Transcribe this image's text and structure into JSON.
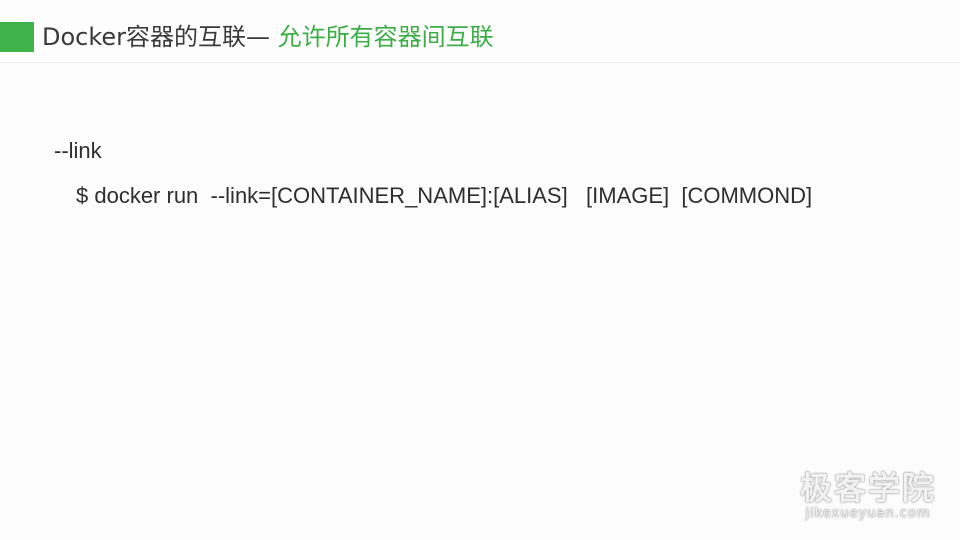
{
  "header": {
    "title_main": "Docker容器的互联— ",
    "title_sub": "允许所有容器间互联"
  },
  "content": {
    "option": "--link",
    "command": "$ docker run  --link=[CONTAINER_NAME]:[ALIAS]   [IMAGE]  [COMMOND]"
  },
  "watermark": {
    "name": "极客学院",
    "url": "jikexueyuan.com"
  },
  "colors": {
    "accent": "#3db34a",
    "title_sub": "#3bae45"
  }
}
